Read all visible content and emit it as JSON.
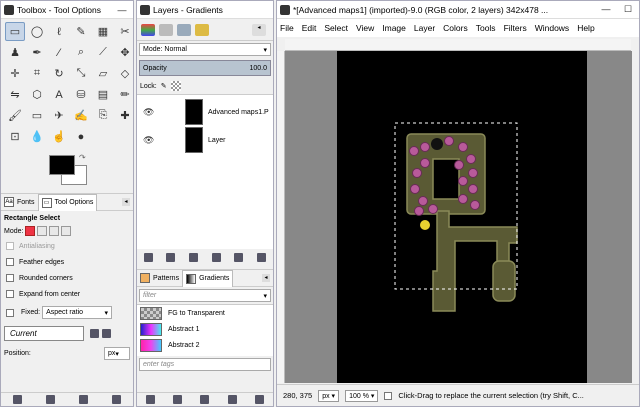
{
  "toolbox": {
    "title": "Toolbox - Tool Options",
    "tab_fonts": "Fonts",
    "tab_tool_options": "Tool Options",
    "tool_title": "Rectangle Select",
    "mode_label": "Mode:",
    "antialiasing": "Antialiasing",
    "feather": "Feather edges",
    "rounded": "Rounded corners",
    "expand": "Expand from center",
    "fixed_label": "Fixed:",
    "fixed_value": "Aspect ratio",
    "current": "Current",
    "position_label": "Position:",
    "position_unit": "px",
    "fonts_icon_text": "Aa"
  },
  "layers": {
    "title": "Layers - Gradients",
    "mode_label": "Mode: Normal",
    "opacity_label": "Opacity",
    "opacity_value": "100.0",
    "lock_label": "Lock:",
    "layer_rows": [
      {
        "name": "Advanced maps1.P"
      },
      {
        "name": "Layer"
      }
    ],
    "tab_patterns": "Patterns",
    "tab_gradients": "Gradients",
    "filter_placeholder": "filter",
    "gradients": [
      {
        "name": "FG to Transparent"
      },
      {
        "name": "Abstract 1"
      },
      {
        "name": "Abstract 2"
      }
    ],
    "tags_placeholder": "enter tags"
  },
  "image": {
    "title": "*[Advanced maps1] (imported)-9.0 (RGB color, 2 layers) 342x478 ...",
    "menu": [
      "File",
      "Edit",
      "Select",
      "View",
      "Image",
      "Layer",
      "Colors",
      "Tools",
      "Filters",
      "Windows",
      "Help"
    ],
    "coords": "280, 375",
    "unit": "px",
    "zoom": "100 %",
    "status": "Click-Drag to replace the current selection (try Shift, C..."
  }
}
